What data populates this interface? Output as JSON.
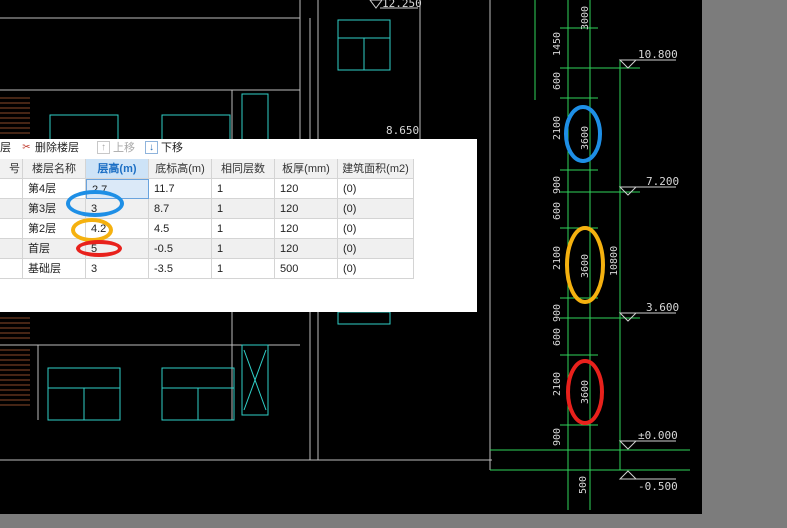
{
  "toolbar": {
    "delete_floor": "删除楼层",
    "move_up": "上移",
    "move_down": "下移",
    "left_clipped": "层"
  },
  "table": {
    "headers": [
      "号",
      "楼层名称",
      "层高(m)",
      "底标高(m)",
      "相同层数",
      "板厚(mm)",
      "建筑面积(m2)"
    ],
    "active_header": "层高(m)",
    "rows": [
      {
        "name": "第4层",
        "height": "2.7",
        "base": "11.7",
        "same": "1",
        "slab": "120",
        "area": "(0)"
      },
      {
        "name": "第3层",
        "height": "3",
        "base": "8.7",
        "same": "1",
        "slab": "120",
        "area": "(0)"
      },
      {
        "name": "第2层",
        "height": "4.2",
        "base": "4.5",
        "same": "1",
        "slab": "120",
        "area": "(0)"
      },
      {
        "name": "首层",
        "height": "5",
        "base": "-0.5",
        "same": "1",
        "slab": "120",
        "area": "(0)"
      },
      {
        "name": "基础层",
        "height": "3",
        "base": "-3.5",
        "same": "1",
        "slab": "500",
        "area": "(0)"
      }
    ]
  },
  "drawing": {
    "elevations": [
      "12.250",
      "10.800",
      "8.650",
      "7.200",
      "3.600",
      "±0.000",
      "-0.500"
    ],
    "dims_left": [
      "3000",
      "1450",
      "600",
      "2100",
      "900",
      "600",
      "2100",
      "900",
      "600",
      "2100",
      "900",
      "500"
    ],
    "dims_mid": [
      "3600",
      "3600",
      "3600"
    ],
    "dim_total": "10800"
  },
  "highlight_colors": {
    "blue": "#1e8fe6",
    "orange": "#f5b10f",
    "red": "#e8211c"
  }
}
